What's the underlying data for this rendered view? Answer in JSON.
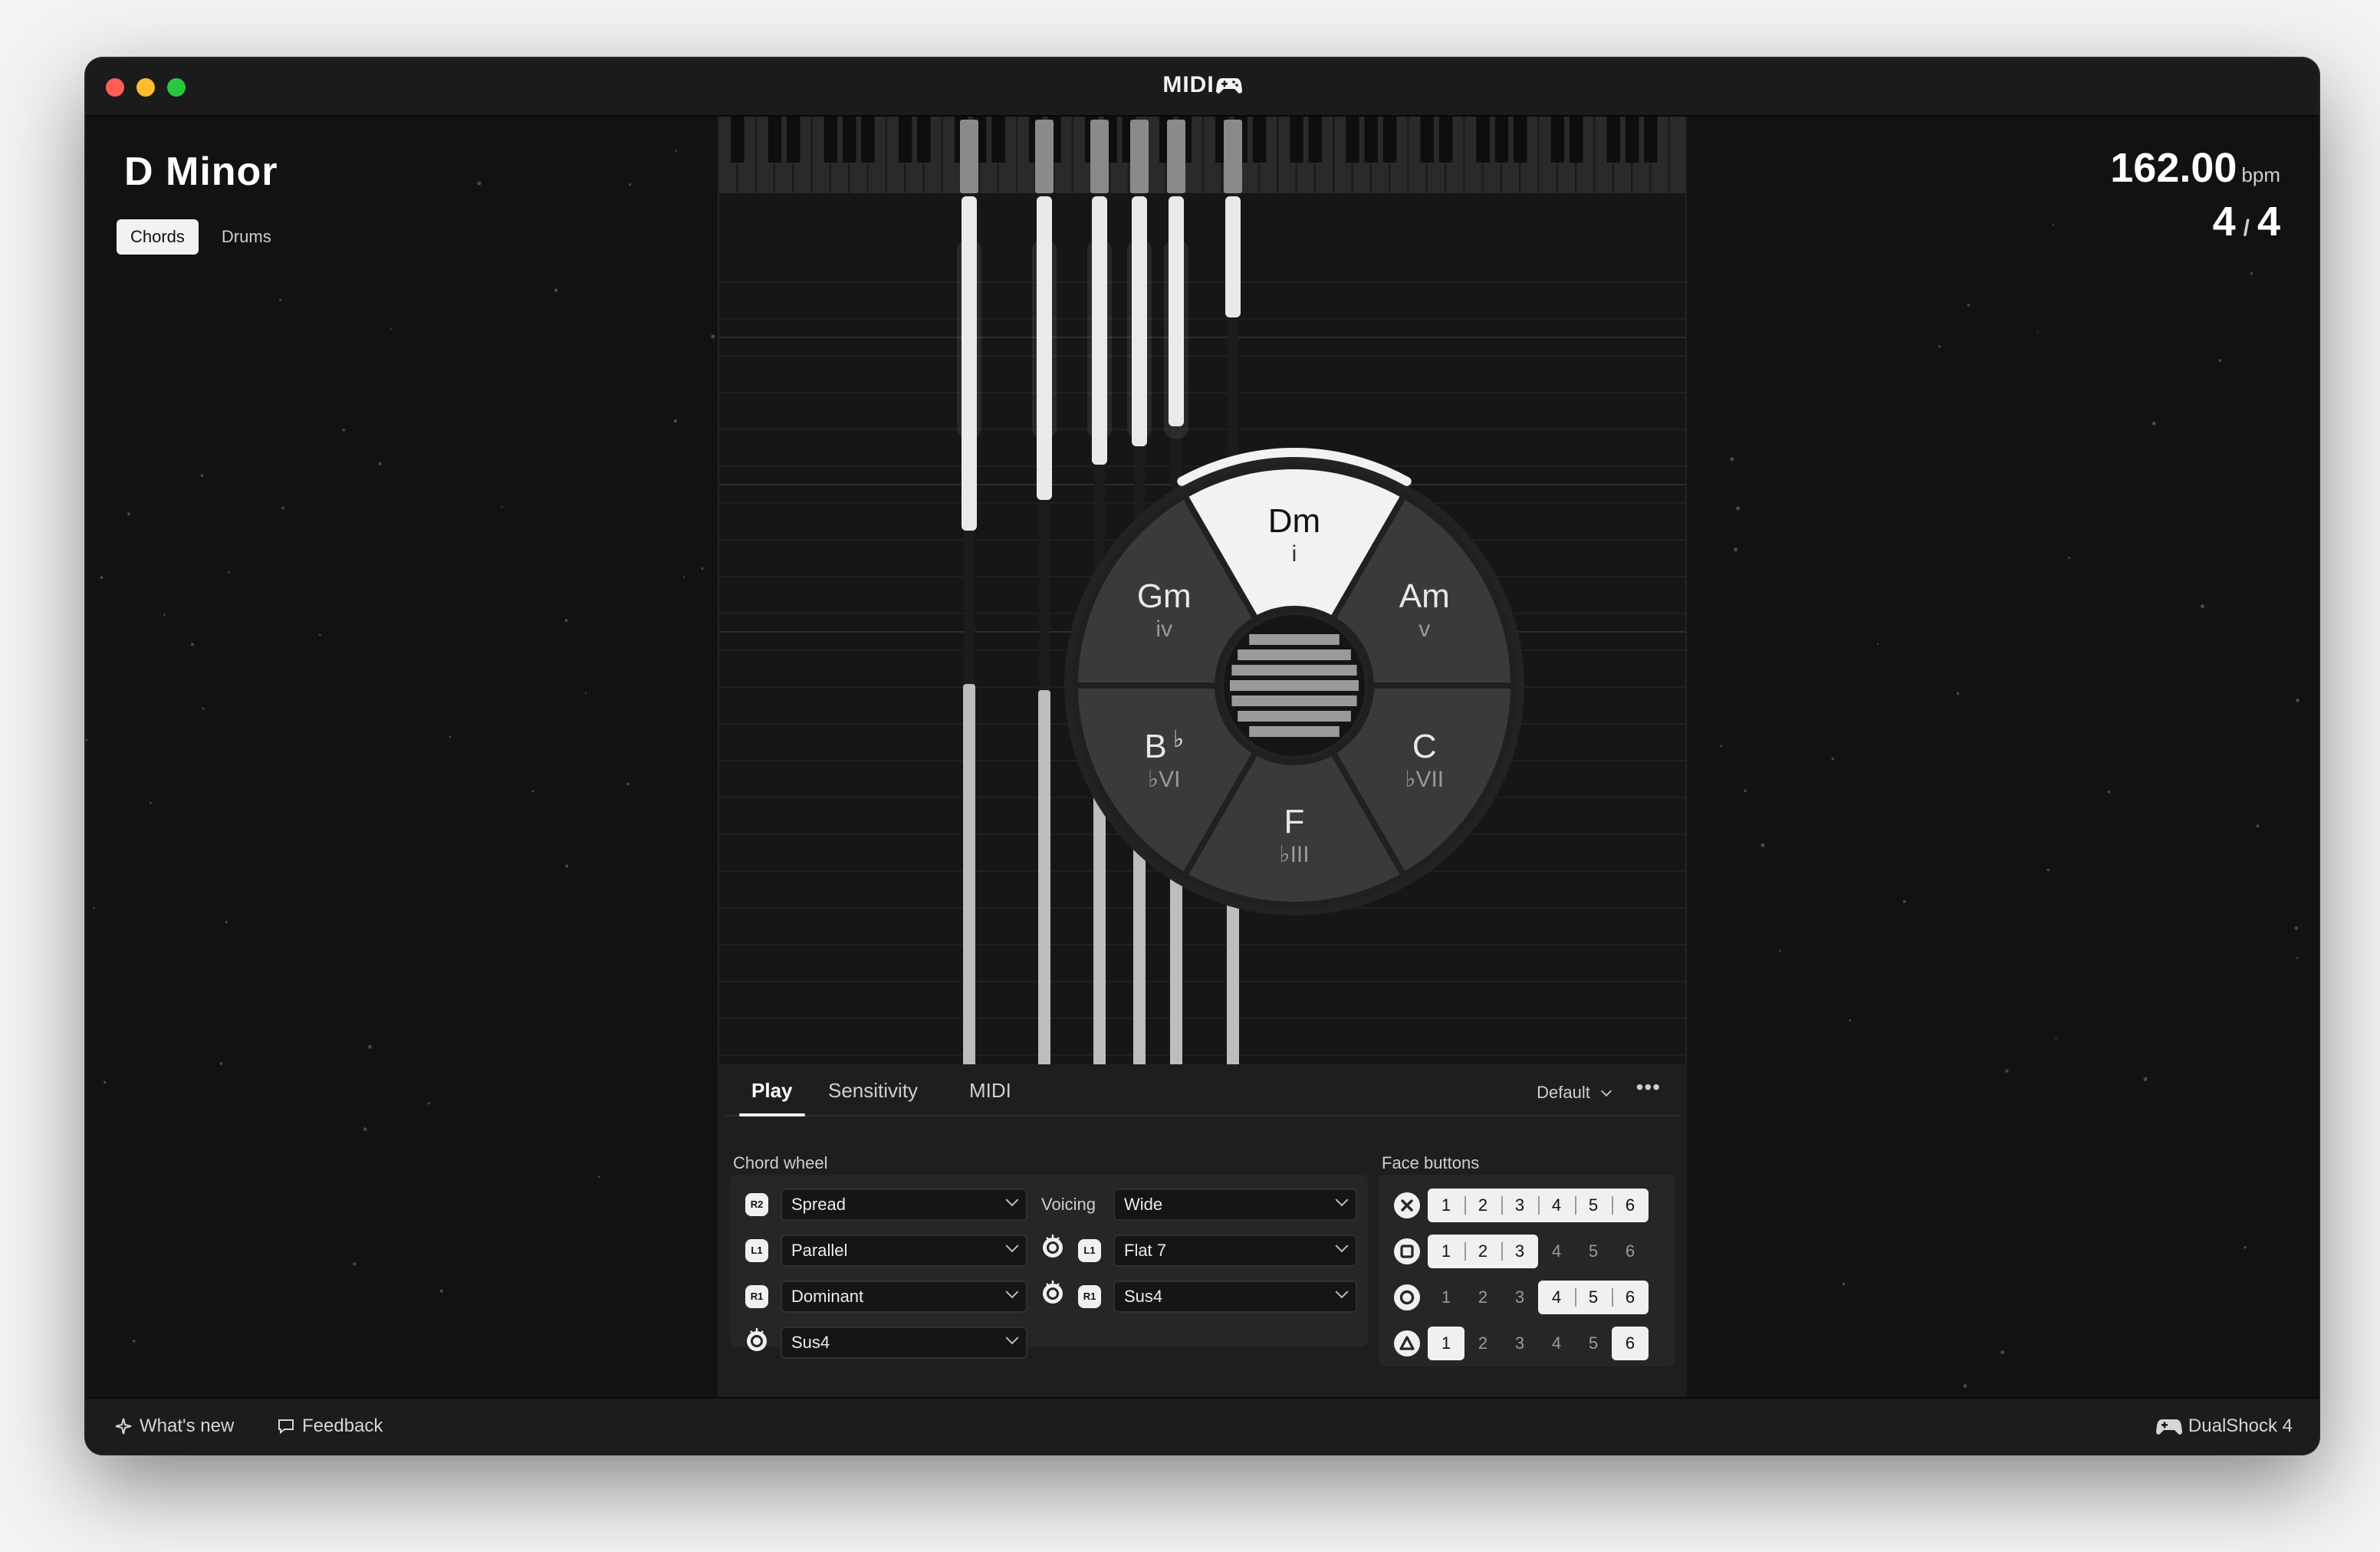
{
  "window": {
    "title": "MIDI",
    "title_icon": "gamepad-icon",
    "traffic_lights": [
      "#ff5f57",
      "#febc2e",
      "#28c840"
    ]
  },
  "key": {
    "name": "D Minor"
  },
  "modes": [
    {
      "label": "Chords",
      "active": true
    },
    {
      "label": "Drums",
      "active": false
    }
  ],
  "tempo": {
    "bpm": "162.00",
    "unit": "bpm",
    "numerator": "4",
    "separator": "/",
    "denominator": "4"
  },
  "chord_wheel": [
    {
      "chord": "Dm",
      "numeral": "i",
      "active": true
    },
    {
      "chord": "Am",
      "numeral": "v",
      "active": false
    },
    {
      "chord": "C",
      "numeral": "VII",
      "flat_numeral": true,
      "active": false
    },
    {
      "chord": "F",
      "numeral": "III",
      "flat_numeral": true,
      "active": false
    },
    {
      "chord": "B",
      "chord_accidental": "♭",
      "numeral": "VI",
      "flat_numeral": true,
      "active": false
    },
    {
      "chord": "Gm",
      "numeral": "iv",
      "active": false
    }
  ],
  "panel": {
    "tabs": [
      {
        "label": "Play",
        "active": true
      },
      {
        "label": "Sensitivity",
        "active": false
      },
      {
        "label": "MIDI",
        "active": false
      }
    ],
    "preset": "Default",
    "more_icon": "more-horizontal-icon",
    "chord_wheel_label": "Chord wheel",
    "voicing_label": "Voicing",
    "left_rows": [
      {
        "control": "R2",
        "value": "Spread"
      },
      {
        "control": "L1",
        "value": "Parallel"
      },
      {
        "control": "R1",
        "value": "Dominant"
      },
      {
        "control": "stick-press",
        "value": "Sus4"
      }
    ],
    "right_rows": [
      {
        "control": "",
        "value": "Wide"
      },
      {
        "control": "stick+L1",
        "value": "Flat 7"
      },
      {
        "control": "stick+R1",
        "value": "Sus4"
      }
    ],
    "face_buttons_label": "Face buttons",
    "face_rows": [
      {
        "button": "cross-icon",
        "numbers": [
          "1",
          "2",
          "3",
          "4",
          "5",
          "6"
        ],
        "on": [
          1,
          2,
          3,
          4,
          5,
          6
        ]
      },
      {
        "button": "square-icon",
        "numbers": [
          "1",
          "2",
          "3",
          "4",
          "5",
          "6"
        ],
        "on": [
          1,
          2,
          3
        ]
      },
      {
        "button": "circle-icon",
        "numbers": [
          "1",
          "2",
          "3",
          "4",
          "5",
          "6"
        ],
        "on": [
          4,
          5,
          6
        ]
      },
      {
        "button": "triangle-icon",
        "numbers": [
          "1",
          "2",
          "3",
          "4",
          "5",
          "6"
        ],
        "on": [
          1,
          6
        ]
      }
    ]
  },
  "footer": {
    "whats_new": "What's new",
    "feedback": "Feedback",
    "controller": "DualShock 4"
  }
}
